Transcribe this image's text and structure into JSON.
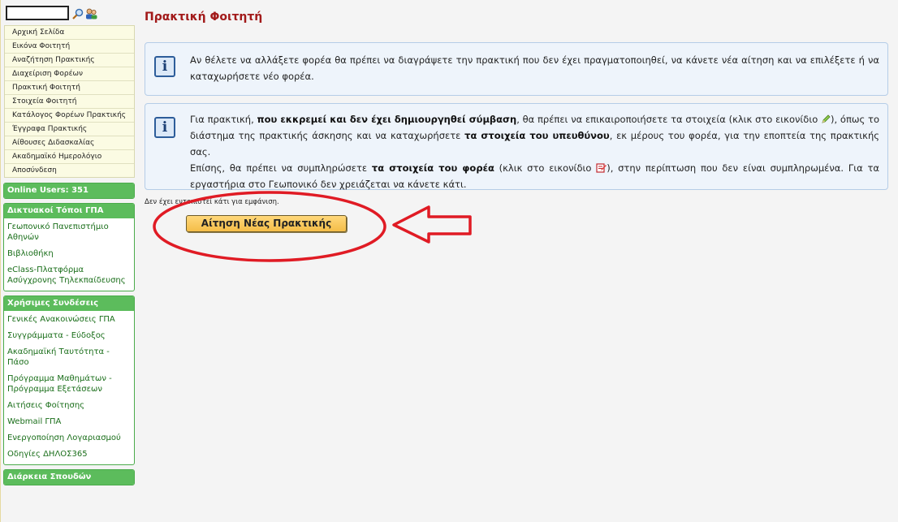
{
  "sidebar": {
    "search": {
      "value": "",
      "placeholder": ""
    },
    "menu": [
      "Αρχική Σελίδα",
      "Εικόνα Φοιτητή",
      "Αναζήτηση Πρακτικής",
      "Διαχείριση Φορέων",
      "Πρακτική Φοιτητή",
      "Στοιχεία Φοιτητή",
      "Κατάλογος Φορέων Πρακτικής",
      "Έγγραφα Πρακτικής",
      "Αίθουσες Διδασκαλίας",
      "Ακαδημαϊκό Ημερολόγιο",
      "Αποσύνδεση"
    ],
    "online_users": "Online Users: 351",
    "websites": {
      "header": "Δικτυακοί Τόποι ΓΠΑ",
      "links": [
        "Γεωπονικό Πανεπιστήμιο Αθηνών",
        "Βιβλιοθήκη",
        "eClass-Πλατφόρμα Ασύγχρονης Τηλεκπαίδευσης"
      ]
    },
    "useful": {
      "header": "Χρήσιμες Συνδέσεις",
      "links": [
        "Γενικές Ανακοινώσεις ΓΠΑ",
        "Συγγράμματα - Εύδοξος",
        "Ακαδημαϊκή Ταυτότητα - Πάσο",
        "Πρόγραμμα Μαθημάτων - Πρόγραμμα Εξετάσεων",
        "Αιτήσεις Φοίτησης",
        "Webmail ΓΠΑ",
        "Ενεργοποίηση Λογαριασμού",
        "Οδηγίες ΔΗΛΟΣ365"
      ]
    },
    "duration": "Διάρκεια Σπουδών"
  },
  "main": {
    "title": "Πρακτική Φοιτητή",
    "info1": {
      "icon": "i",
      "text": "Αν θέλετε να αλλάξετε φορέα θα πρέπει να διαγράψετε την πρακτική που δεν έχει πραγματοποιηθεί, να κάνετε νέα αίτηση και να επιλέξετε ή να καταχωρήσετε νέο φορέα."
    },
    "info2": {
      "icon": "i",
      "p1": "Για πρακτική, ",
      "b1": "που εκκρεμεί και δεν έχει δημιουργηθεί σύμβαση",
      "p2": ", θα πρέπει να επικαιροποιήσετε τα στοιχεία (κλικ στο εικονίδιο ",
      "p3": "), όπως το διάστημα της πρακτικής άσκησης και να καταχωρήσετε ",
      "b2": "τα στοιχεία του υπευθύνου",
      "p4": ", εκ μέρους του φορέα, για την εποπτεία της πρακτικής σας.",
      "p5": "Επίσης, θα πρέπει να συμπληρώσετε ",
      "b3": "τα στοιχεία του φορέα",
      "p6": " (κλικ στο εικονίδιο ",
      "p7": "), στην περίπτωση που δεν είναι συμπληρωμένα. Για τα εργαστήρια στο Γεωπονικό δεν χρειάζεται να κάνετε κάτι."
    },
    "status": "Δεν έχει εντοπιστεί κάτι για εμφάνιση.",
    "apply_button": "Αίτηση Νέας Πρακτικής"
  },
  "colors": {
    "title": "#a21a1a",
    "panel_header": "#5cbc5c",
    "annotation": "#e01b24"
  },
  "icons": [
    "search-icon",
    "users-icon",
    "info-icon",
    "pencil-icon",
    "edit-note-icon"
  ]
}
